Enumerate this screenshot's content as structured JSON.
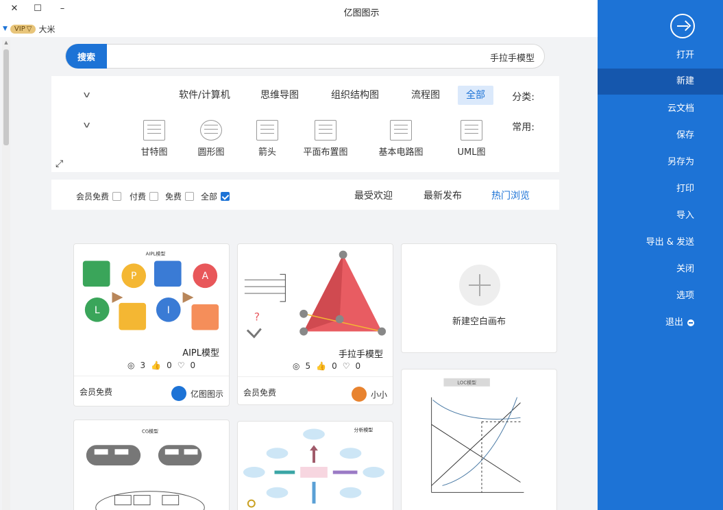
{
  "window": {
    "title": "亿图图示",
    "close": "✕",
    "maximize": "☐",
    "minimize": "–"
  },
  "user": {
    "vip": "VIP",
    "name": "大米"
  },
  "search": {
    "button": "搜索",
    "query": "手拉手模型"
  },
  "filter": {
    "category_label": "分类:",
    "categories": [
      "全部",
      "流程图",
      "组织结构图",
      "思维导图",
      "软件/计算机"
    ],
    "common_label": "常用:",
    "templates": [
      "UML图",
      "基本电路图",
      "平面布置图",
      "箭头",
      "圆形图",
      "甘特图"
    ]
  },
  "sort": {
    "tabs": [
      "热门浏览",
      "最新发布",
      "最受欢迎"
    ],
    "checks": [
      "全部",
      "免费",
      "付费",
      "会员免费"
    ]
  },
  "new_card": {
    "label": "新建空白画布"
  },
  "cards": [
    {
      "title": "AIPL模型",
      "views": "3",
      "likes": "0",
      "favs": "0",
      "author": "亿图图示",
      "price": "会员免费",
      "thumb_title": "AIPL模型"
    },
    {
      "title": "手拉手模型",
      "views": "5",
      "likes": "0",
      "favs": "0",
      "author": "小小",
      "price": "会员免费"
    },
    {
      "thumb_title": "CG模型"
    },
    {
      "thumb_title": "分析模型"
    },
    {
      "thumb_title": "LOC模型"
    }
  ],
  "sidebar": {
    "items": [
      "打开",
      "新建",
      "云文档",
      "保存",
      "另存为",
      "打印",
      "导入",
      "导出 & 发送",
      "关闭",
      "选项",
      "退出"
    ],
    "active": "新建"
  },
  "colors": {
    "accent": "#1d73d6",
    "sidebar_active": "#1557ad",
    "pyramid": "#e85c62"
  }
}
